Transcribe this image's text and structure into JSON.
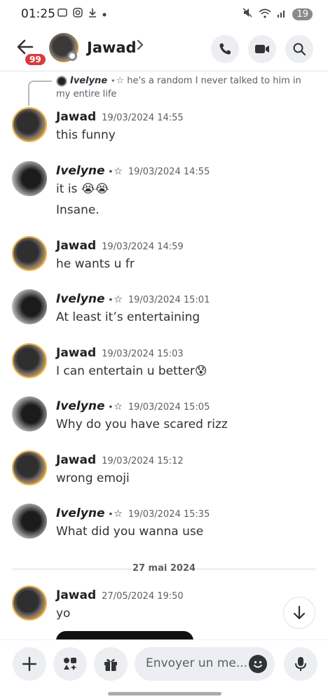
{
  "status_bar": {
    "time": "01:25",
    "battery": "19"
  },
  "header": {
    "title": "Jawad",
    "unread_count": "99"
  },
  "reply_preview": {
    "author": "Ivelyne",
    "stars": "⋆☆",
    "text": "he's a random I never talked to him in my entire life"
  },
  "messages": [
    {
      "author": "Jawad",
      "stars": "",
      "time": "19/03/2024 14:55",
      "lines": [
        "this funny"
      ]
    },
    {
      "author": "Ivelyne",
      "stars": "⋆☆",
      "time": "19/03/2024 14:55",
      "lines": [
        "it is 😭😭",
        "Insane."
      ]
    },
    {
      "author": "Jawad",
      "stars": "",
      "time": "19/03/2024 14:59",
      "lines": [
        "he wants u fr"
      ]
    },
    {
      "author": "Ivelyne",
      "stars": "⋆☆",
      "time": "19/03/2024 15:01",
      "lines": [
        "At least it’s entertaining"
      ]
    },
    {
      "author": "Jawad",
      "stars": "",
      "time": "19/03/2024 15:03",
      "lines": [
        "I can entertain u better😰"
      ]
    },
    {
      "author": "Ivelyne",
      "stars": "⋆☆",
      "time": "19/03/2024 15:05",
      "lines": [
        "Why do you have scared rizz"
      ]
    },
    {
      "author": "Jawad",
      "stars": "",
      "time": "19/03/2024 15:12",
      "lines": [
        "wrong emoji"
      ]
    },
    {
      "author": "Ivelyne",
      "stars": "⋆☆",
      "time": "19/03/2024 15:35",
      "lines": [
        "What did you wanna use"
      ]
    },
    {
      "author": "Jawad",
      "stars": "",
      "time": "27/05/2024 19:50",
      "lines": [
        "yo"
      ]
    }
  ],
  "date_divider": "27 mai 2024",
  "composer": {
    "placeholder": "Envoyer un me..."
  },
  "icons": {
    "back": "arrow-left-icon",
    "call": "phone-icon",
    "video": "video-camera-icon",
    "search": "search-icon",
    "add": "plus-icon",
    "apps": "apps-icon",
    "gift": "gift-icon",
    "emoji": "emoji-icon",
    "mic": "microphone-icon",
    "scroll": "arrow-down-icon"
  },
  "colors": {
    "badge": "#d83c3e",
    "button_bg": "#eceef1",
    "text": "#2e3338",
    "muted": "#5c5e66"
  }
}
